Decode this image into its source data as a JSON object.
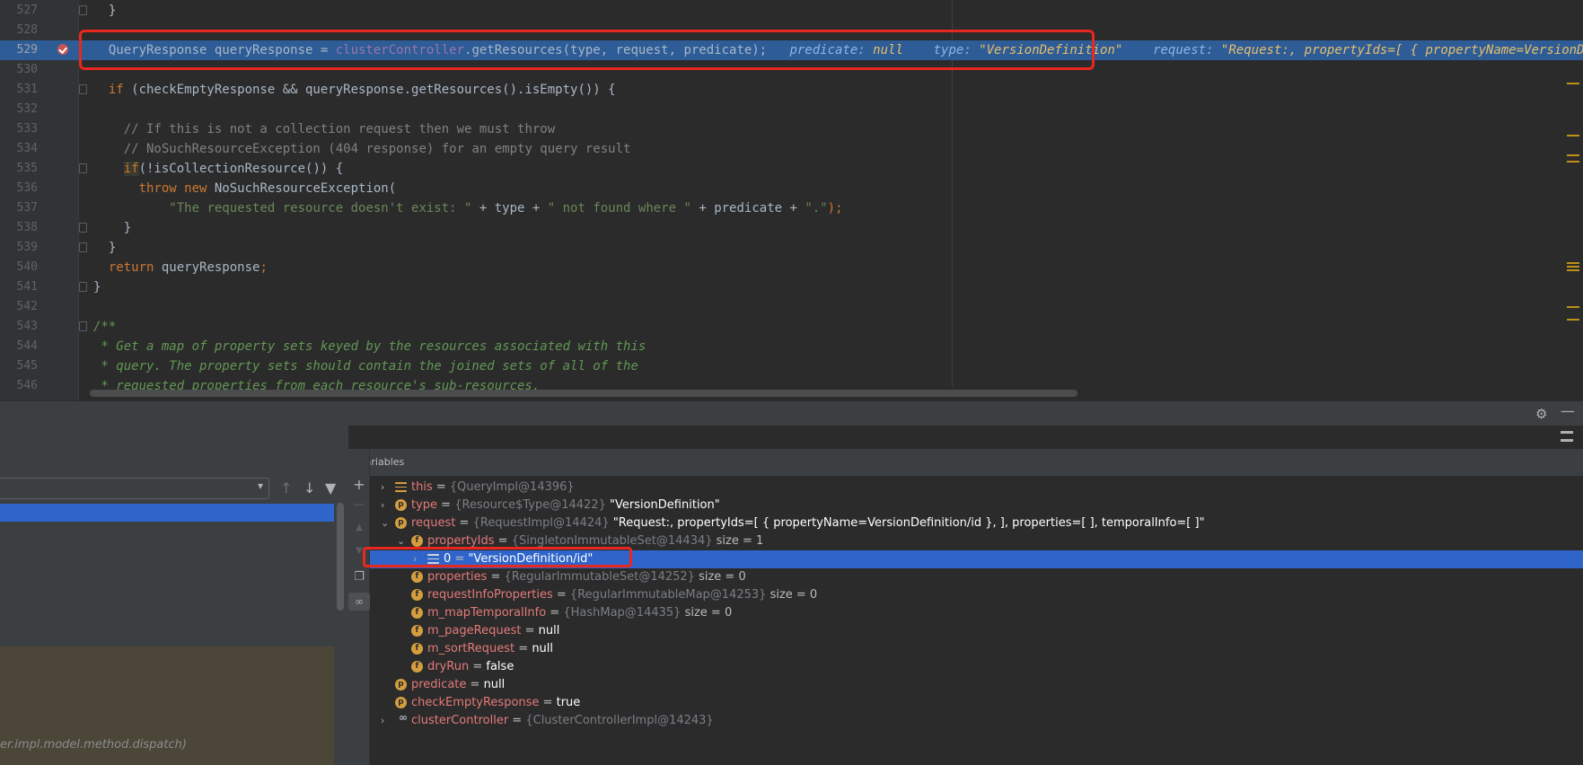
{
  "editor": {
    "lines": [
      {
        "num": "527",
        "html": "<span class=\"veq\">  }</span>"
      },
      {
        "num": "528",
        "html": ""
      },
      {
        "num": "529",
        "html": "  QueryResponse queryResponse = <span class=\"fld\">clusterController</span>.getResources(type, request, predicate);   <span class=\"hint\">predicate: </span><span class=\"hintv\">null</span>    <span class=\"hint\">type: </span><span class=\"hintv\">\"VersionDefinition\"</span>    <span class=\"hint\">request: </span><span class=\"hintv\">\"Request:, propertyIds=[ { propertyName=VersionDefinition/</span>"
      },
      {
        "num": "530",
        "html": ""
      },
      {
        "num": "531",
        "html": "  <span class=\"kw\">if</span> (checkEmptyResponse &amp;&amp; queryResponse.getResources().isEmpty()) {"
      },
      {
        "num": "532",
        "html": ""
      },
      {
        "num": "533",
        "html": "    <span class=\"cmt\">// If this is not a collection request then we must throw</span>"
      },
      {
        "num": "534",
        "html": "    <span class=\"cmt\">// NoSuchResourceException (404 response) for an empty query result</span>"
      },
      {
        "num": "535",
        "html": "    <span class=\"ifhl\">if</span>(!isCollectionResource()) {"
      },
      {
        "num": "536",
        "html": "      <span class=\"kw\">throw new</span> NoSuchResourceException("
      },
      {
        "num": "537",
        "html": "          <span class=\"str\">\"The requested resource doesn't exist: \"</span> + type + <span class=\"str\">\" not found where \"</span> + predicate + <span class=\"str\">\".\"</span><span class=\"kw\">);</span>"
      },
      {
        "num": "538",
        "html": "    }"
      },
      {
        "num": "539",
        "html": "  }"
      },
      {
        "num": "540",
        "html": "  <span class=\"kw\">return</span> queryResponse<span class=\"kw\">;</span>"
      },
      {
        "num": "541",
        "html": "}"
      },
      {
        "num": "542",
        "html": ""
      },
      {
        "num": "543",
        "html": "<span class=\"doc\">/**</span>"
      },
      {
        "num": "544",
        "html": "<span class=\"doc\"> * Get a map of property sets keyed by the resources associated with this</span>"
      },
      {
        "num": "545",
        "html": "<span class=\"doc\"> * query. The property sets should contain the joined sets of all of the</span>"
      },
      {
        "num": "546",
        "html": "<span class=\"doc\"> * requested properties from each resource's sub-resources.</span>"
      }
    ]
  },
  "frames": {
    "last_frame_text": "er.impl.model.method.dispatch)"
  },
  "variables": {
    "header": "Variables",
    "rows": [
      {
        "indent": 0,
        "arrow": "›",
        "icon": "list",
        "name": "this",
        "type": "{QueryImpl@14396}",
        "value": "",
        "size": ""
      },
      {
        "indent": 0,
        "arrow": "›",
        "icon": "p",
        "name": "type",
        "type": "{Resource$Type@14422}",
        "value": "\"VersionDefinition\"",
        "size": ""
      },
      {
        "indent": 0,
        "arrow": "⌄",
        "icon": "p",
        "name": "request",
        "type": "{RequestImpl@14424}",
        "value": "\"Request:, propertyIds=[ { propertyName=VersionDefinition/id },  ], properties=[  ], temporalInfo=[ ]\"",
        "size": ""
      },
      {
        "indent": 1,
        "arrow": "⌄",
        "icon": "f",
        "name": "propertyIds",
        "type": "{SingletonImmutableSet@14434}",
        "value": "",
        "size": "size = 1"
      },
      {
        "indent": 2,
        "arrow": "›",
        "icon": "list-w",
        "name": "0",
        "type": "",
        "value": "\"VersionDefinition/id\"",
        "size": "",
        "selected": true
      },
      {
        "indent": 1,
        "arrow": "",
        "icon": "f",
        "name": "properties",
        "type": "{RegularImmutableSet@14252}",
        "value": "",
        "size": "size = 0"
      },
      {
        "indent": 1,
        "arrow": "",
        "icon": "f",
        "name": "requestInfoProperties",
        "type": "{RegularImmutableMap@14253}",
        "value": "",
        "size": "size = 0"
      },
      {
        "indent": 1,
        "arrow": "",
        "icon": "f",
        "name": "m_mapTemporalInfo",
        "type": "{HashMap@14435}",
        "value": "",
        "size": "size = 0"
      },
      {
        "indent": 1,
        "arrow": "",
        "icon": "f",
        "name": "m_pageRequest",
        "type": "",
        "value": "null",
        "size": ""
      },
      {
        "indent": 1,
        "arrow": "",
        "icon": "f",
        "name": "m_sortRequest",
        "type": "",
        "value": "null",
        "size": ""
      },
      {
        "indent": 1,
        "arrow": "",
        "icon": "f",
        "name": "dryRun",
        "type": "",
        "value": "false",
        "size": ""
      },
      {
        "indent": 0,
        "arrow": "",
        "icon": "p",
        "name": "predicate",
        "type": "",
        "value": "null",
        "size": ""
      },
      {
        "indent": 0,
        "arrow": "",
        "icon": "p",
        "name": "checkEmptyResponse",
        "type": "",
        "value": "true",
        "size": ""
      },
      {
        "indent": 0,
        "arrow": "›",
        "icon": "glass",
        "name": "clusterController",
        "type": "{ClusterControllerImpl@14243}",
        "value": "",
        "size": ""
      }
    ]
  },
  "icons": {
    "add": "add-watch-icon",
    "remove": "remove-watch-icon",
    "up": "move-up-icon",
    "down": "move-down-icon",
    "copy": "copy-icon",
    "watches": "glasses-icon",
    "gear": "gear-icon",
    "minimize": "minimize-icon",
    "filter": "filter-icon"
  },
  "colors": {
    "highlight_box": "#e8281f",
    "selection": "#2f65ca",
    "exec_line": "#2d5c97"
  }
}
